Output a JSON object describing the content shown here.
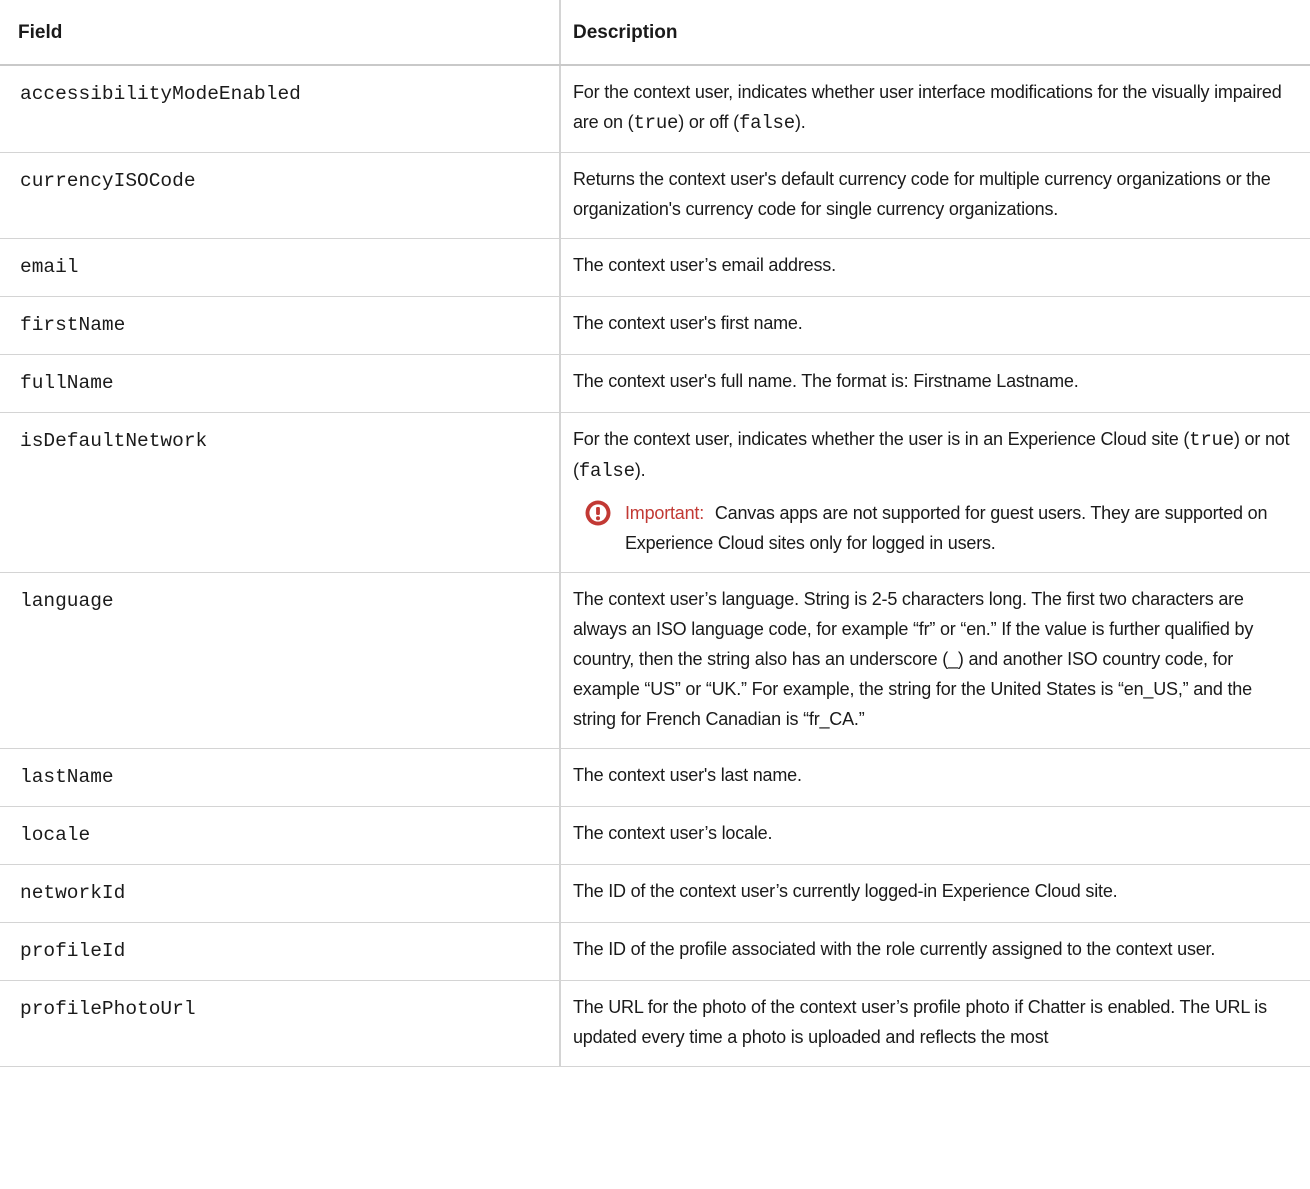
{
  "table": {
    "headers": {
      "field": "Field",
      "description": "Description"
    },
    "rows": [
      {
        "field": "accessibilityModeEnabled",
        "desc_before": "For the context user, indicates whether user interface modifications for the visually impaired are on (",
        "code1": "true",
        "desc_middle": ") or off (",
        "code2": "false",
        "desc_after": ")."
      },
      {
        "field": "currencyISOCode",
        "description": "Returns the context user's default currency code for multiple currency organizations or the organization's currency code for single currency organizations."
      },
      {
        "field": "email",
        "description": "The context user’s email address."
      },
      {
        "field": "firstName",
        "description": "The context user's first name."
      },
      {
        "field": "fullName",
        "description": "The context user's full name. The format is: Firstname Lastname."
      },
      {
        "field": "isDefaultNetwork",
        "desc_before": "For the context user, indicates whether the user is in an Experience Cloud site (",
        "code1": "true",
        "desc_middle": ") or not (",
        "code2": "false",
        "desc_after": ").",
        "important": {
          "label": "Important:",
          "text": "Canvas apps are not supported for guest users. They are supported on Experience Cloud sites only for logged in users.",
          "icon": "exclamation-circle-icon",
          "color": "#c23934"
        }
      },
      {
        "field": "language",
        "description": "The context user’s language. String is 2-5 characters long. The first two characters are always an ISO language code, for example “fr” or “en.” If the value is further qualified by country, then the string also has an underscore (_) and another ISO country code, for example “US” or “UK.” For example, the string for the United States is “en_US,” and the string for French Canadian is “fr_CA.”"
      },
      {
        "field": "lastName",
        "description": "The context user's last name."
      },
      {
        "field": "locale",
        "description": "The context user’s locale."
      },
      {
        "field": "networkId",
        "description": "The ID of the context user’s currently logged-in Experience Cloud site."
      },
      {
        "field": "profileId",
        "description": "The ID of the profile associated with the role currently assigned to the context user."
      },
      {
        "field": "profilePhotoUrl",
        "description": "The URL for the photo of the context user’s profile photo if Chatter is enabled. The URL is updated every time a photo is uploaded and reflects the most"
      }
    ]
  }
}
